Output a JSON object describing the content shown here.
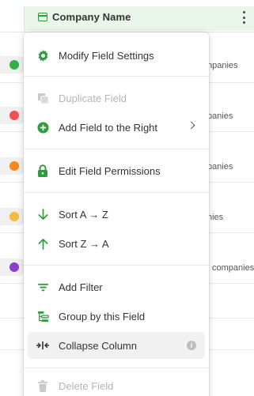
{
  "header": {
    "column_title": "Company Name"
  },
  "rows": [
    {
      "dot_color": "#2fb344",
      "text": "npanies"
    },
    {
      "dot_color": "#f05252",
      "text": "panies"
    },
    {
      "dot_color": "#f5891f",
      "text": "panies"
    },
    {
      "dot_color": "#f7b93e",
      "text": "nies"
    },
    {
      "dot_color": "#8a3fd1",
      "text": "companies"
    }
  ],
  "menu": {
    "items": [
      {
        "label": "Modify Field Settings",
        "icon": "gear-icon"
      },
      {
        "label": "Duplicate Field",
        "icon": "duplicate-icon",
        "disabled": true
      },
      {
        "label": "Add Field to the Right",
        "icon": "plus-circle-icon",
        "submenu": true
      },
      {
        "label": "Edit Field Permissions",
        "icon": "lock-icon"
      },
      {
        "label": "Sort A → Z",
        "icon": "arrow-down-icon"
      },
      {
        "label": "Sort Z → A",
        "icon": "arrow-up-icon"
      },
      {
        "label": "Add Filter",
        "icon": "filter-icon"
      },
      {
        "label": "Group by this Field",
        "icon": "group-icon"
      },
      {
        "label": "Collapse Column",
        "icon": "collapse-icon",
        "highlighted": true
      },
      {
        "label": "Delete Field",
        "icon": "trash-icon",
        "disabled": true
      }
    ]
  },
  "colors": {
    "accent": "#2e9d3c",
    "disabled": "#b5b5b5",
    "header_bg": "#eaf6ea"
  }
}
